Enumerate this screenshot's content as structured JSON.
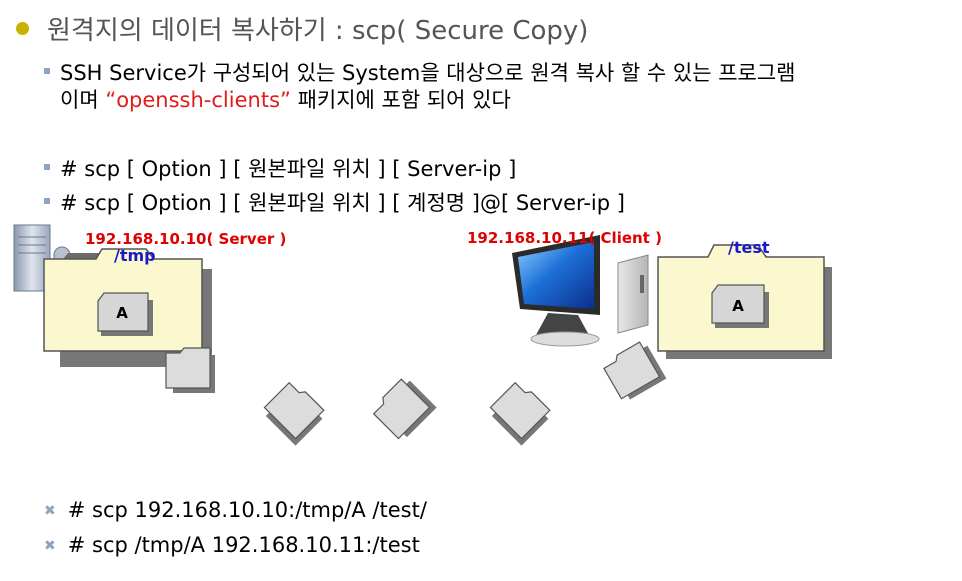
{
  "title": "원격지의 데이터 복사하기 : scp( Secure Copy)",
  "description": {
    "line1": "SSH Service가 구성되어 있는 System을 대상으로 원격 복사 할 수 있는 프로그램",
    "line2_prefix": "이며 ",
    "line2_highlight": "“openssh-clients”",
    "line2_suffix": " 패키지에 포함 되어 있다"
  },
  "syntax": [
    "# scp [ Option ] [ 원본파일 위치 ] [ Server-ip ]",
    "# scp [ Option ] [ 원본파일 위치 ] [ 계정명 ]@[ Server-ip ]"
  ],
  "diagram": {
    "server_ip": "192.168.10.10( Server )",
    "server_dir": "/tmp",
    "server_file": "A",
    "client_ip": "192.168.10.11( Client )",
    "client_dir": "/test",
    "client_file": "A"
  },
  "examples": [
    "# scp 192.168.10.10:/tmp/A  /test/",
    "# scp /tmp/A  192.168.10.11:/test"
  ],
  "colors": {
    "highlight": "#e21b1b",
    "ip_label": "#e00000",
    "dir_label": "#1a1ac8",
    "folder_fill": "#fbf7cf",
    "bullet": "#c8b400"
  }
}
